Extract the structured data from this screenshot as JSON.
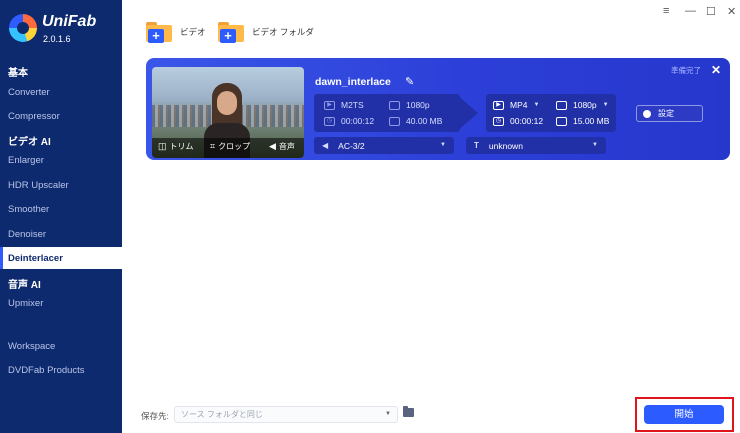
{
  "app": {
    "name": "UniFab",
    "version": "2.0.1.6"
  },
  "sidebar": {
    "sections": [
      {
        "title": "基本",
        "items": [
          "Converter",
          "Compressor"
        ]
      },
      {
        "title": "ビデオ AI",
        "items": [
          "Enlarger",
          "HDR Upscaler",
          "Smoother",
          "Denoiser",
          "Deinterlacer"
        ]
      },
      {
        "title": "音声 AI",
        "items": [
          "Upmixer"
        ]
      }
    ],
    "active": "Deinterlacer",
    "footer": [
      "Workspace",
      "DVDFab Products"
    ]
  },
  "toolbar": {
    "add_video": "ビデオ",
    "add_folder": "ビデオ フォルダ"
  },
  "window_controls": [
    "≡",
    "—",
    "☐",
    "✕"
  ],
  "task": {
    "filename": "dawn_interlace",
    "status": "準備完了",
    "thumb_actions": {
      "trim": "トリム",
      "crop": "クロップ",
      "audio": "音声"
    },
    "source": {
      "format": "M2TS",
      "resolution": "1080p",
      "duration": "00:00:12",
      "size": "40.00 MB"
    },
    "output": {
      "format": "MP4",
      "resolution": "1080p",
      "duration": "00:00:12",
      "size": "15.00 MB"
    },
    "settings_label": "設定",
    "audio_track": "AC-3/2",
    "subtitle": "unknown"
  },
  "bottom": {
    "save_label": "保存先:",
    "save_path": "ソース フォルダと同じ",
    "start_label": "開始"
  },
  "colors": {
    "sidebar": "#0e2a6e",
    "card": "#2c3fd8",
    "accent": "#2c5cff",
    "highlight": "#e0141b"
  }
}
